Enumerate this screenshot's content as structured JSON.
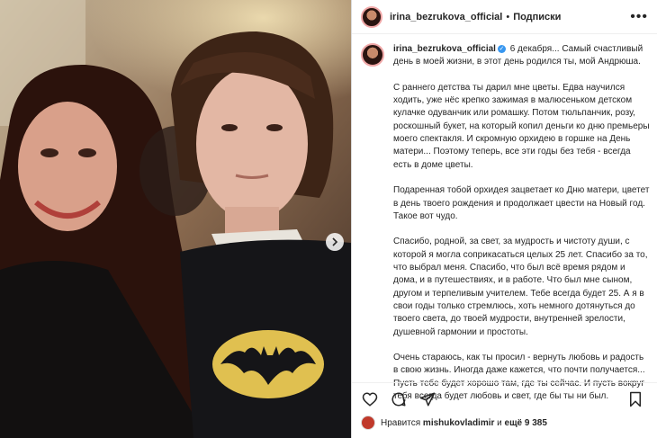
{
  "post": {
    "username": "irina_bezrukova_official",
    "separator": "•",
    "follow_label": "Подписки",
    "more_glyph": "•••",
    "caption": {
      "username": "irina_bezrukova_official",
      "verified_glyph": "✓",
      "date": "6 декабря",
      "first_line": "... Самый счастливый день в моей жизни, в этот день родился ты, мой Андрюша.",
      "paragraphs": [
        "С раннего детства ты дарил мне цветы. Едва научился ходить, уже нёс крепко зажимая в малюсеньком детском кулачке одуванчик или ромашку. Потом тюльпанчик, розу, роскошный букет, на который копил деньги ко дню премьеры моего спектакля. И скромную орхидею в горшке на День матери... Поэтому теперь, все эти годы без тебя - всегда есть в доме цветы.",
        "Подаренная тобой орхидея зацветает ко Дню матери, цветет в день твоего рождения и продолжает цвести на Новый год. Такое вот чудо.",
        "Спасибо, родной, за свет, за мудрость и чистоту души, с которой я могла соприкасаться целых 25 лет. Спасибо за то, что выбрал меня. Спасибо, что был всё время рядом и дома, и в путешествиях, и в работе. Что был мне сыном, другом и терпеливым учителем. Тебе всегда будет 25. А я в свои годы только стремлюсь, хоть немного дотянуться до твоего света, до твоей мудрости, внутренней зрелости, душевной гармонии и простоты.",
        "Очень стараюсь, как ты просил - вернуть любовь и радость в свою жизнь. Иногда даже кажется, что почти получается... Пусть тебе будет хорошо там, где ты сейчас. И пусть вокруг тебя всегда будет любовь и свет, где бы ты ни был."
      ]
    },
    "likes": {
      "prefix": "Нравится",
      "user": "mishukovladimir",
      "middle": "и",
      "others": "ещё 9 385"
    },
    "icons": {
      "like": "heart-icon",
      "comment": "comment-icon",
      "share": "send-icon",
      "save": "bookmark-icon",
      "next": "chevron-right-icon"
    },
    "colors": {
      "text": "#262626",
      "border": "#dbdbdb",
      "verified": "#3897f0"
    }
  }
}
